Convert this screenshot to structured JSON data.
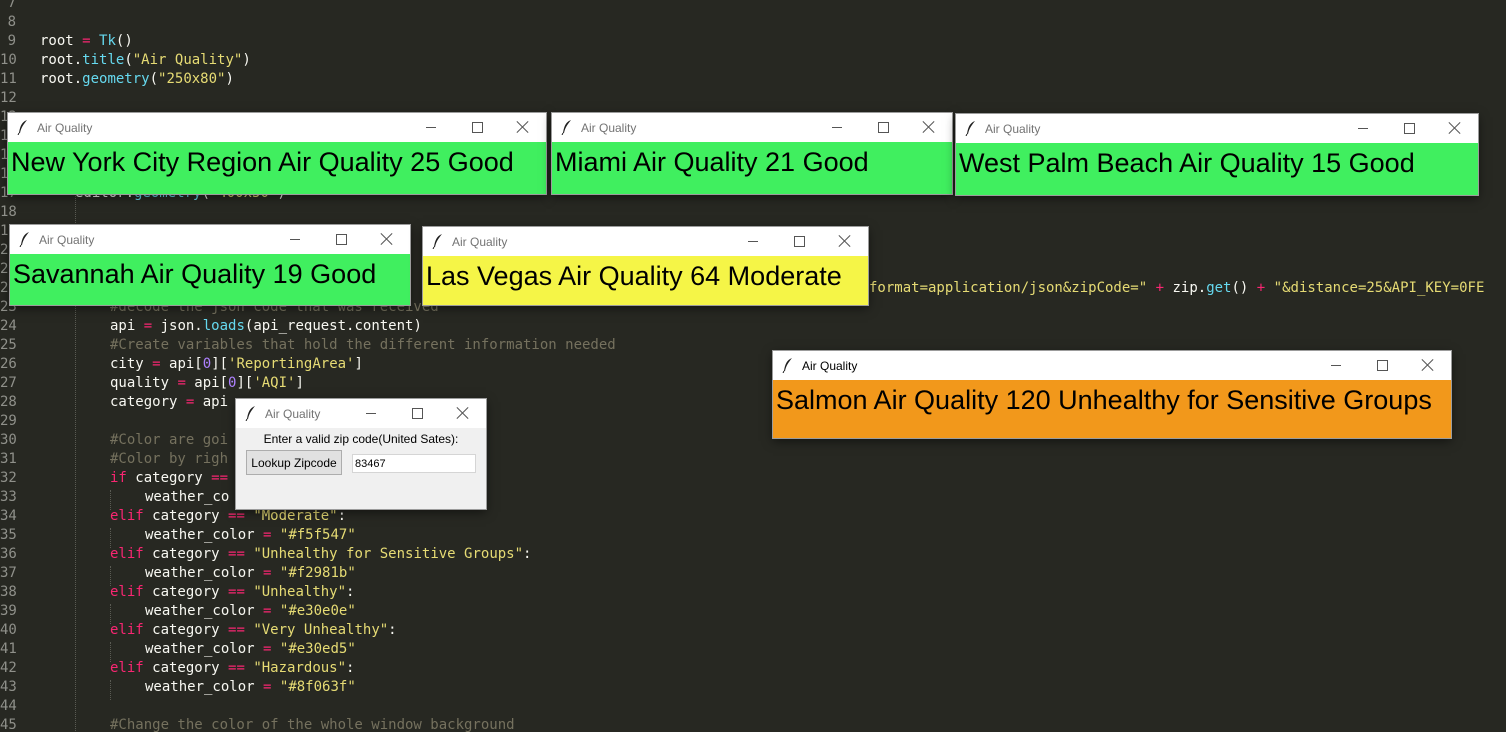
{
  "editor": {
    "lines": [
      {
        "n": "7",
        "indent": 0,
        "tokens": []
      },
      {
        "n": "8",
        "indent": 0,
        "tokens": []
      },
      {
        "n": "9",
        "indent": 0,
        "tokens": [
          [
            "id",
            "root "
          ],
          [
            "op",
            "="
          ],
          [
            "id",
            " "
          ],
          [
            "fn",
            "Tk"
          ],
          [
            "id",
            "()"
          ]
        ]
      },
      {
        "n": "10",
        "indent": 0,
        "tokens": [
          [
            "id",
            "root."
          ],
          [
            "fn",
            "title"
          ],
          [
            "id",
            "("
          ],
          [
            "str",
            "\"Air Quality\""
          ],
          [
            "id",
            ")"
          ]
        ]
      },
      {
        "n": "11",
        "indent": 0,
        "tokens": [
          [
            "id",
            "root."
          ],
          [
            "fn",
            "geometry"
          ],
          [
            "id",
            "("
          ],
          [
            "str",
            "\"250x80\""
          ],
          [
            "id",
            ")"
          ]
        ]
      },
      {
        "n": "12",
        "indent": 0,
        "tokens": []
      },
      {
        "n": "13",
        "indent": 0,
        "tokens": []
      },
      {
        "n": "14",
        "indent": 0,
        "tokens": []
      },
      {
        "n": "15",
        "indent": 0,
        "tokens": []
      },
      {
        "n": "16",
        "indent": 0,
        "tokens": []
      },
      {
        "n": "17",
        "indent": 1,
        "tokens": [
          [
            "id",
            "editor."
          ],
          [
            "fn",
            "geometry"
          ],
          [
            "id",
            "("
          ],
          [
            "str",
            "\"400x50\""
          ],
          [
            "id",
            ")"
          ]
        ]
      },
      {
        "n": "18",
        "indent": 0,
        "tokens": []
      },
      {
        "n": "19",
        "indent": 0,
        "tokens": []
      },
      {
        "n": "20",
        "indent": 0,
        "tokens": []
      },
      {
        "n": "21",
        "indent": 0,
        "tokens": []
      },
      {
        "n": "22",
        "indent": 0,
        "tokens": [
          [
            "str",
            "format=application/json&zipCode=\""
          ],
          [
            "id",
            " "
          ],
          [
            "op",
            "+"
          ],
          [
            "id",
            " zip."
          ],
          [
            "fn",
            "get"
          ],
          [
            "id",
            "() "
          ],
          [
            "op",
            "+"
          ],
          [
            "id",
            " "
          ],
          [
            "str",
            "\"&distance=25&API_KEY=0FE"
          ]
        ]
      },
      {
        "n": "23",
        "indent": 2,
        "tokens": [
          [
            "cm",
            "#decode the json code that was received"
          ]
        ]
      },
      {
        "n": "24",
        "indent": 2,
        "tokens": [
          [
            "id",
            "api "
          ],
          [
            "op",
            "="
          ],
          [
            "id",
            " json."
          ],
          [
            "fn",
            "loads"
          ],
          [
            "id",
            "(api_request.content)"
          ]
        ]
      },
      {
        "n": "25",
        "indent": 2,
        "tokens": [
          [
            "cm",
            "#Create variables that hold the different information needed"
          ]
        ]
      },
      {
        "n": "26",
        "indent": 2,
        "tokens": [
          [
            "id",
            "city "
          ],
          [
            "op",
            "="
          ],
          [
            "id",
            " api["
          ],
          [
            "num",
            "0"
          ],
          [
            "id",
            "]["
          ],
          [
            "str",
            "'ReportingArea'"
          ],
          [
            "id",
            "]"
          ]
        ]
      },
      {
        "n": "27",
        "indent": 2,
        "tokens": [
          [
            "id",
            "quality "
          ],
          [
            "op",
            "="
          ],
          [
            "id",
            " api["
          ],
          [
            "num",
            "0"
          ],
          [
            "id",
            "]["
          ],
          [
            "str",
            "'AQI'"
          ],
          [
            "id",
            "]"
          ]
        ]
      },
      {
        "n": "28",
        "indent": 2,
        "tokens": [
          [
            "id",
            "category "
          ],
          [
            "op",
            "="
          ],
          [
            "id",
            " api"
          ]
        ]
      },
      {
        "n": "29",
        "indent": 0,
        "tokens": []
      },
      {
        "n": "30",
        "indent": 2,
        "tokens": [
          [
            "cm",
            "#Color are goi"
          ]
        ]
      },
      {
        "n": "31",
        "indent": 2,
        "tokens": [
          [
            "cm",
            "#Color by righ"
          ]
        ]
      },
      {
        "n": "32",
        "indent": 2,
        "tokens": [
          [
            "kw",
            "if"
          ],
          [
            "id",
            " category "
          ],
          [
            "op",
            "=="
          ]
        ]
      },
      {
        "n": "33",
        "indent": 3,
        "tokens": [
          [
            "id",
            "weather_co"
          ]
        ]
      },
      {
        "n": "34",
        "indent": 2,
        "tokens": [
          [
            "kw",
            "elif"
          ],
          [
            "id",
            " category "
          ],
          [
            "op",
            "=="
          ],
          [
            "id",
            " "
          ],
          [
            "str",
            "\"Moderate\""
          ],
          [
            "id",
            ":"
          ]
        ]
      },
      {
        "n": "35",
        "indent": 3,
        "tokens": [
          [
            "id",
            "weather_color "
          ],
          [
            "op",
            "="
          ],
          [
            "id",
            " "
          ],
          [
            "str",
            "\"#f5f547\""
          ]
        ]
      },
      {
        "n": "36",
        "indent": 2,
        "tokens": [
          [
            "kw",
            "elif"
          ],
          [
            "id",
            " category "
          ],
          [
            "op",
            "=="
          ],
          [
            "id",
            " "
          ],
          [
            "str",
            "\"Unhealthy for Sensitive Groups\""
          ],
          [
            "id",
            ":"
          ]
        ]
      },
      {
        "n": "37",
        "indent": 3,
        "tokens": [
          [
            "id",
            "weather_color "
          ],
          [
            "op",
            "="
          ],
          [
            "id",
            " "
          ],
          [
            "str",
            "\"#f2981b\""
          ]
        ]
      },
      {
        "n": "38",
        "indent": 2,
        "tokens": [
          [
            "kw",
            "elif"
          ],
          [
            "id",
            " category "
          ],
          [
            "op",
            "=="
          ],
          [
            "id",
            " "
          ],
          [
            "str",
            "\"Unhealthy\""
          ],
          [
            "id",
            ":"
          ]
        ]
      },
      {
        "n": "39",
        "indent": 3,
        "tokens": [
          [
            "id",
            "weather_color "
          ],
          [
            "op",
            "="
          ],
          [
            "id",
            " "
          ],
          [
            "str",
            "\"#e30e0e\""
          ]
        ]
      },
      {
        "n": "40",
        "indent": 2,
        "tokens": [
          [
            "kw",
            "elif"
          ],
          [
            "id",
            " category "
          ],
          [
            "op",
            "=="
          ],
          [
            "id",
            " "
          ],
          [
            "str",
            "\"Very Unhealthy\""
          ],
          [
            "id",
            ":"
          ]
        ]
      },
      {
        "n": "41",
        "indent": 3,
        "tokens": [
          [
            "id",
            "weather_color "
          ],
          [
            "op",
            "="
          ],
          [
            "id",
            " "
          ],
          [
            "str",
            "\"#e30ed5\""
          ]
        ]
      },
      {
        "n": "42",
        "indent": 2,
        "tokens": [
          [
            "kw",
            "elif"
          ],
          [
            "id",
            " category "
          ],
          [
            "op",
            "=="
          ],
          [
            "id",
            " "
          ],
          [
            "str",
            "\"Hazardous\""
          ],
          [
            "id",
            ":"
          ]
        ]
      },
      {
        "n": "43",
        "indent": 3,
        "tokens": [
          [
            "id",
            "weather_color "
          ],
          [
            "op",
            "="
          ],
          [
            "id",
            " "
          ],
          [
            "str",
            "\"#8f063f\""
          ]
        ]
      },
      {
        "n": "44",
        "indent": 0,
        "tokens": []
      },
      {
        "n": "45",
        "indent": 2,
        "tokens": [
          [
            "cm",
            "#Change the color of the whole window background"
          ]
        ]
      }
    ]
  },
  "windows": {
    "nyc": {
      "title": "Air Quality",
      "text": "New York City Region Air Quality 25 Good",
      "color": "#40ef5f"
    },
    "miami": {
      "title": "Air Quality",
      "text": "Miami Air Quality 21 Good",
      "color": "#40ef5f"
    },
    "wpb": {
      "title": "Air Quality",
      "text": "West Palm Beach Air Quality 15 Good",
      "color": "#40ef5f"
    },
    "savannah": {
      "title": "Air Quality",
      "text": "Savannah Air Quality 19 Good",
      "color": "#40ef5f"
    },
    "vegas": {
      "title": "Air Quality",
      "text": "Las Vegas Air Quality 64 Moderate",
      "color": "#f5f547"
    },
    "salmon": {
      "title": "Air Quality",
      "text": "Salmon Air Quality 120 Unhealthy for Sensitive Groups",
      "color": "#f2981b"
    },
    "zip": {
      "title": "Air Quality",
      "prompt": "Enter a valid zip code(United Sates):",
      "button": "Lookup Zipcode",
      "value": "83467"
    }
  }
}
